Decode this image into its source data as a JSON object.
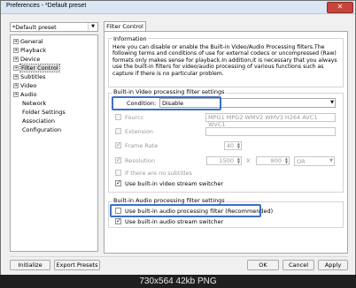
{
  "window": {
    "title": "Preferences - *Default preset",
    "close_glyph": "✕"
  },
  "preset": {
    "value": "*Default preset"
  },
  "tree": {
    "items": [
      {
        "label": "General",
        "expandable": true
      },
      {
        "label": "Playback",
        "expandable": true
      },
      {
        "label": "Device",
        "expandable": true
      },
      {
        "label": "Filter Control",
        "expandable": true,
        "selected": true
      },
      {
        "label": "Subtitles",
        "expandable": true
      },
      {
        "label": "Video",
        "expandable": true
      },
      {
        "label": "Audio",
        "expandable": true
      },
      {
        "label": "Network",
        "expandable": false
      },
      {
        "label": "Folder Settings",
        "expandable": false
      },
      {
        "label": "Association",
        "expandable": false
      },
      {
        "label": "Configuration",
        "expandable": false
      }
    ]
  },
  "tab": {
    "label": "Filter Control"
  },
  "information": {
    "title": "Information",
    "text": "Here you can disable or enable the Built-in Video/Audio Processing filters.The following terms and conditions of use for external codecs or uncompressed (Raw) formats only makes sense for playback.In addition,it is necessary that you always use the built-in filters for video/audio processing of various functions such as capture if there is no particular problem."
  },
  "video": {
    "title": "Built-in Video processing filter settings",
    "condition_label": "Condition:",
    "condition_value": "Disable",
    "fourcc_label": "Fourcc",
    "fourcc_value": "MPG1 MPG2 WMV2 WMV3 H264 AVC1 WVC1",
    "extension_label": "Extension",
    "frame_rate_label": "Frame Rate",
    "frame_rate_value": "40",
    "resolution_label": "Resolution",
    "res_width": "1500",
    "res_sep": "X",
    "res_height": "800",
    "res_op": "OR",
    "no_subs_label": "If there are no subtitles",
    "stream_switcher_label": "Use built-in video stream switcher"
  },
  "audio": {
    "title": "Built-in Audio processing filter settings",
    "processing_label": "Use built-in audio processing filter (Recommended)",
    "stream_switcher_label": "Use built-in audio stream switcher"
  },
  "buttons": {
    "initialize": "Initialize",
    "export": "Export Presets",
    "ok": "OK",
    "cancel": "Cancel",
    "apply": "Apply"
  },
  "caption": {
    "text": "730x564  42kb  PNG"
  },
  "colors": {
    "highlight": "#3d6fc8",
    "titlebar": "#dbe6f4",
    "close": "#c7443a"
  }
}
